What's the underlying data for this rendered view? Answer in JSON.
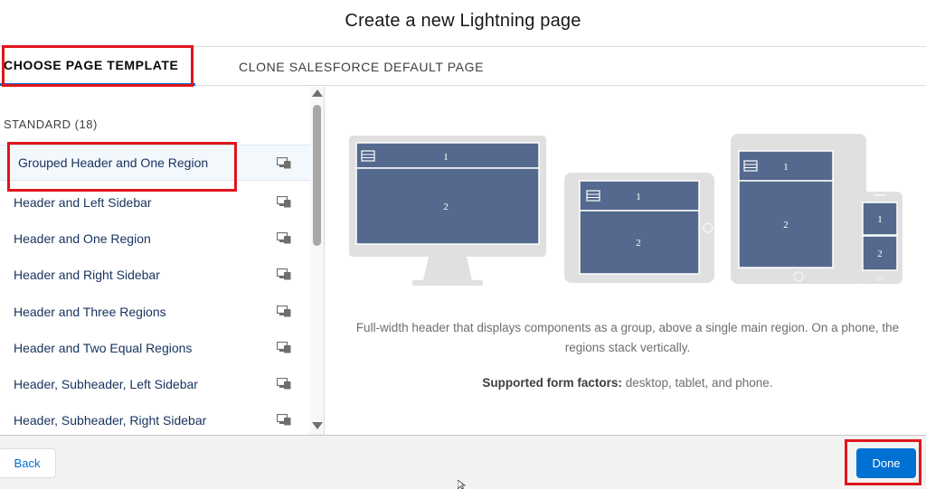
{
  "modal": {
    "title": "Create a new Lightning page"
  },
  "tabs": [
    {
      "label": "CHOOSE PAGE TEMPLATE",
      "active": true
    },
    {
      "label": "CLONE SALESFORCE DEFAULT PAGE",
      "active": false
    }
  ],
  "template_list": {
    "section_label": "STANDARD (18)",
    "items": [
      {
        "label": "Grouped Header and One Region",
        "selected": true
      },
      {
        "label": "Header and Left Sidebar"
      },
      {
        "label": "Header and One Region"
      },
      {
        "label": "Header and Right Sidebar"
      },
      {
        "label": "Header and Three Regions"
      },
      {
        "label": "Header and Two Equal Regions"
      },
      {
        "label": "Header, Subheader, Left Sidebar"
      },
      {
        "label": "Header, Subheader, Right Sidebar"
      }
    ]
  },
  "preview": {
    "region_labels": {
      "header": "1",
      "main": "2"
    },
    "description": "Full-width header that displays components as a group, above a single main region. On a phone, the regions stack vertically.",
    "form_factors_label": "Supported form factors:",
    "form_factors_value": "desktop, tablet, and phone."
  },
  "footer": {
    "back_label": "Back",
    "done_label": "Done"
  },
  "colors": {
    "brand": "#0070d2",
    "region_fill": "#54698d",
    "device_frame": "#e0e0e0",
    "annotation": "#e0151c"
  },
  "icons": {
    "template_item": "device-form-factor-icon",
    "region_header": "list-icon"
  }
}
